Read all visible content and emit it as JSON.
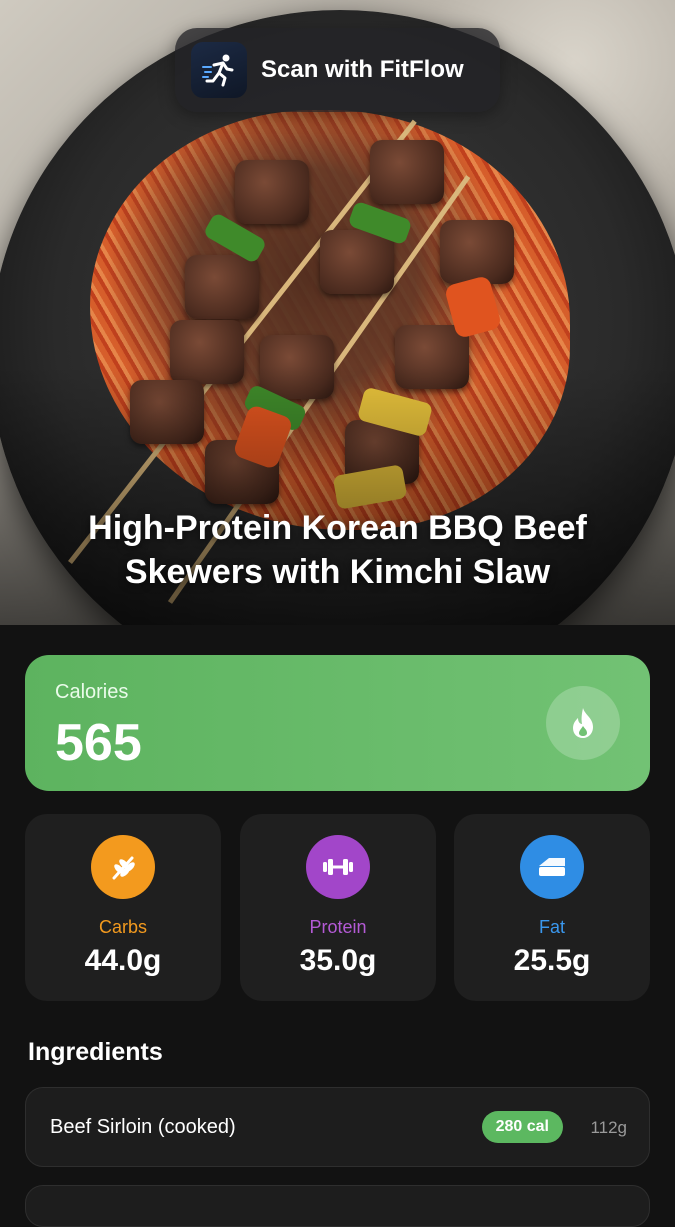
{
  "scan_button": {
    "label": "Scan with FitFlow",
    "logo_icon": "running-figure-icon"
  },
  "recipe": {
    "title": "High-Protein Korean BBQ Beef Skewers with Kimchi Slaw"
  },
  "calories": {
    "label": "Calories",
    "value": "565",
    "icon": "flame-icon",
    "color": "#5db35f"
  },
  "macros": [
    {
      "name": "Carbs",
      "value": "44.0g",
      "icon": "wheat-icon",
      "color": "#f39a1e"
    },
    {
      "name": "Protein",
      "value": "35.0g",
      "icon": "dumbbell-icon",
      "color": "#a246c9"
    },
    {
      "name": "Fat",
      "value": "25.5g",
      "icon": "butter-icon",
      "color": "#2f8de4"
    }
  ],
  "ingredients": {
    "title": "Ingredients",
    "items": [
      {
        "name": "Beef Sirloin (cooked)",
        "calories": "280 cal",
        "weight": "112g"
      }
    ]
  }
}
